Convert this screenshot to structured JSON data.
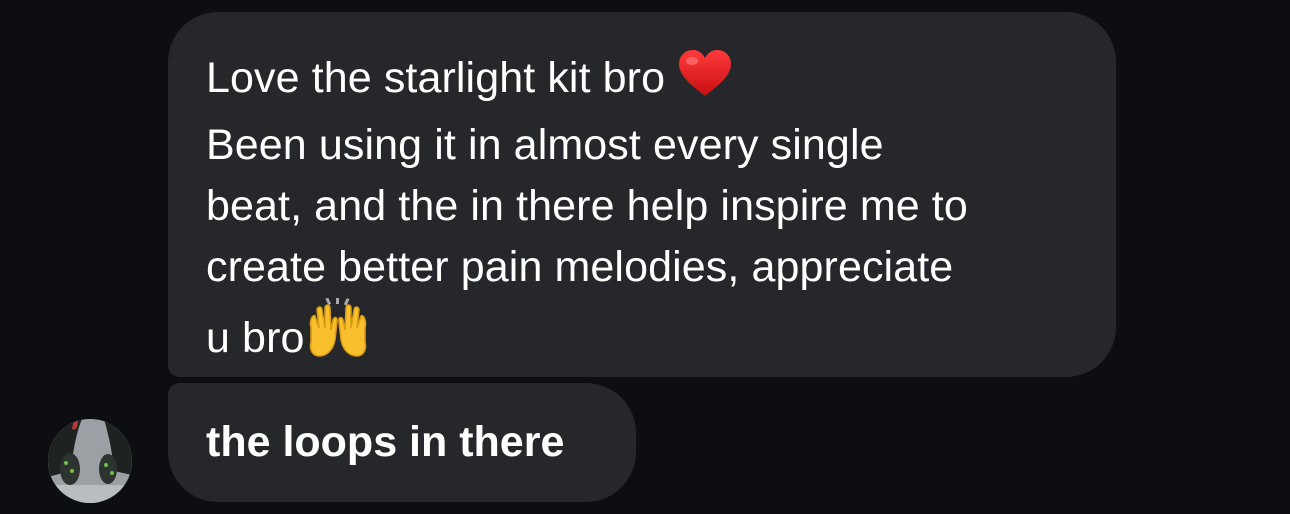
{
  "messages": [
    {
      "lines": [
        "Love the starlight kit bro",
        "Been using it in almost every single",
        "beat, and the in there help inspire me to",
        "create better pain melodies, appreciate",
        "u bro"
      ],
      "emojis": [
        "red-heart-icon",
        "raising-hands-icon"
      ]
    },
    {
      "text": "the loops in there"
    }
  ],
  "colors": {
    "background": "#0c0e11",
    "bubble": "#25272b",
    "text": "#ffffff"
  }
}
